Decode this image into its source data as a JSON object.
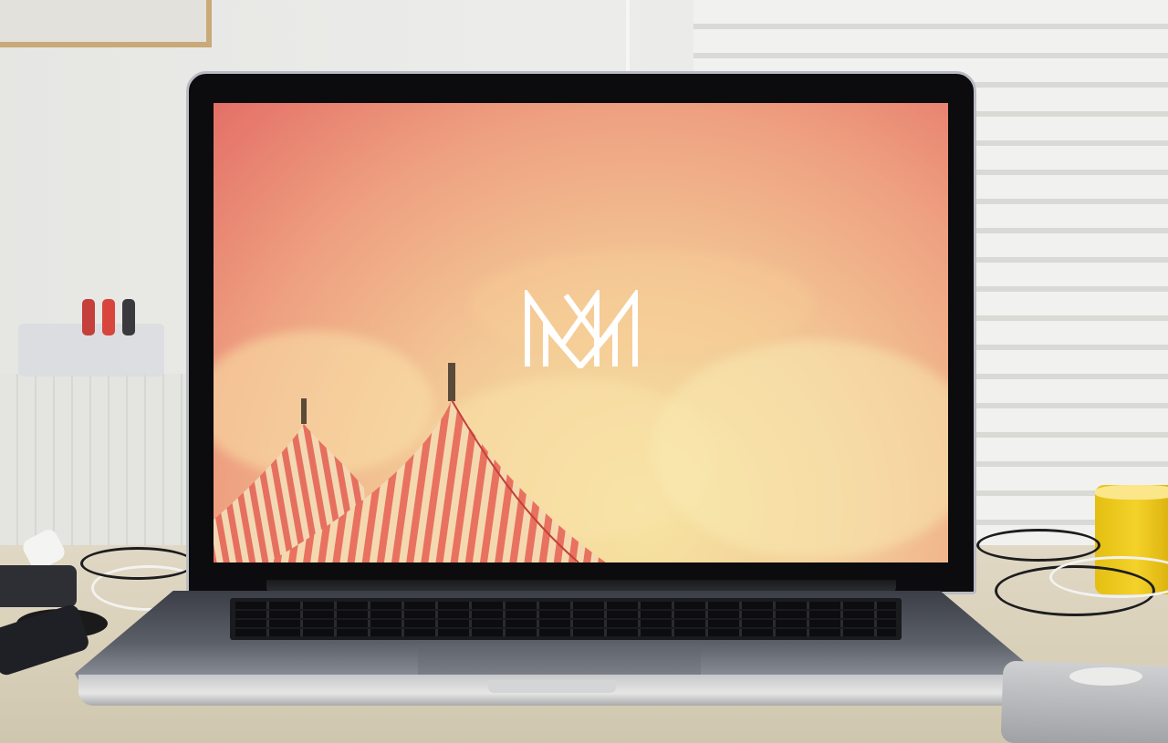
{
  "scene": {
    "description_tag": "laptop-on-desk-photo",
    "screen_logo_letters": "MM",
    "colors": {
      "sky_top": "#e46f67",
      "sky_mid": "#eea080",
      "sky_low": "#f6e6a2",
      "tent_stripe_red": "#e8725f",
      "tent_stripe_cream": "#f4d9b0",
      "tape_yellow": "#f4d22a",
      "laptop_bezel": "#0c0c0e",
      "laptop_aluminum": "#bfc1c4"
    }
  }
}
